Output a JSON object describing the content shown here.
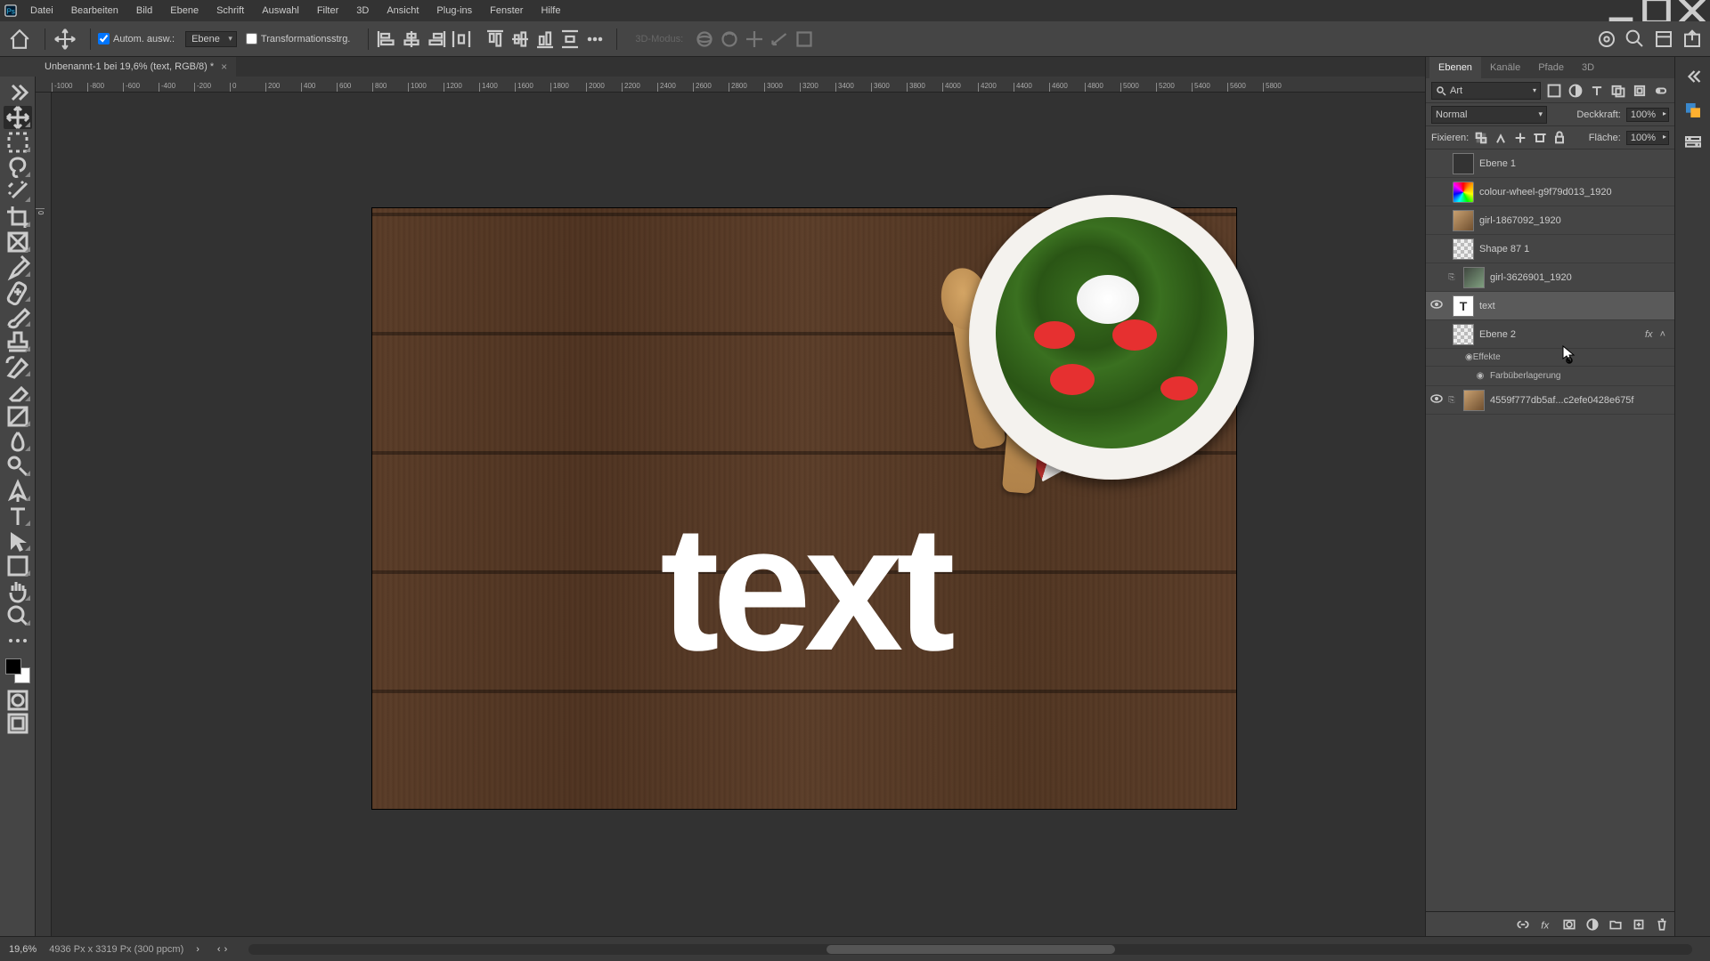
{
  "menubar": {
    "items": [
      "Datei",
      "Bearbeiten",
      "Bild",
      "Ebene",
      "Schrift",
      "Auswahl",
      "Filter",
      "3D",
      "Ansicht",
      "Plug-ins",
      "Fenster",
      "Hilfe"
    ]
  },
  "optionsbar": {
    "auto_select_label": "Autom. ausw.:",
    "target_dropdown": "Ebene",
    "transform_label": "Transformationsstrg.",
    "mode3d_label": "3D-Modus:"
  },
  "document": {
    "tab_title": "Unbenannt-1 bei 19,6% (text, RGB/8) *",
    "canvas_text": "Text"
  },
  "ruler_ticks": [
    "-1000",
    "-800",
    "-600",
    "-400",
    "-200",
    "0",
    "200",
    "400",
    "600",
    "800",
    "1000",
    "1200",
    "1400",
    "1600",
    "1800",
    "2000",
    "2200",
    "2400",
    "2600",
    "2800",
    "3000",
    "3200",
    "3400",
    "3600",
    "3800",
    "4000",
    "4200",
    "4400",
    "4600",
    "4800",
    "5000",
    "5200",
    "5400",
    "5600",
    "5800"
  ],
  "panels": {
    "tabs": [
      "Ebenen",
      "Kanäle",
      "Pfade",
      "3D"
    ],
    "search_label": "Art",
    "blend_mode": "Normal",
    "opacity_label": "Deckkraft:",
    "opacity_value": "100%",
    "lock_label": "Fixieren:",
    "fill_label": "Fläche:",
    "fill_value": "100%",
    "layers": [
      {
        "visible": false,
        "name": "Ebene 1",
        "thumb": "solid"
      },
      {
        "visible": false,
        "name": "colour-wheel-g9f79d013_1920",
        "thumb": "color-wheel"
      },
      {
        "visible": false,
        "name": "girl-1867092_1920",
        "thumb": "photo1"
      },
      {
        "visible": false,
        "name": "Shape 87 1",
        "thumb": "checker"
      },
      {
        "visible": false,
        "name": "girl-3626901_1920",
        "thumb": "photo2",
        "linked": true
      },
      {
        "visible": true,
        "name": "text",
        "thumb": "text",
        "selected": true
      },
      {
        "visible": false,
        "name": "Ebene 2",
        "thumb": "checker",
        "fx": true
      },
      {
        "visible": true,
        "name": "4559f777db5af...c2efe0428e675f",
        "thumb": "photo1",
        "linked": true
      }
    ],
    "fx_title": "Effekte",
    "fx_items": [
      "Farbüberlagerung"
    ]
  },
  "statusbar": {
    "zoom": "19,6%",
    "dims": "4936 Px x 3319 Px (300 ppcm)"
  }
}
